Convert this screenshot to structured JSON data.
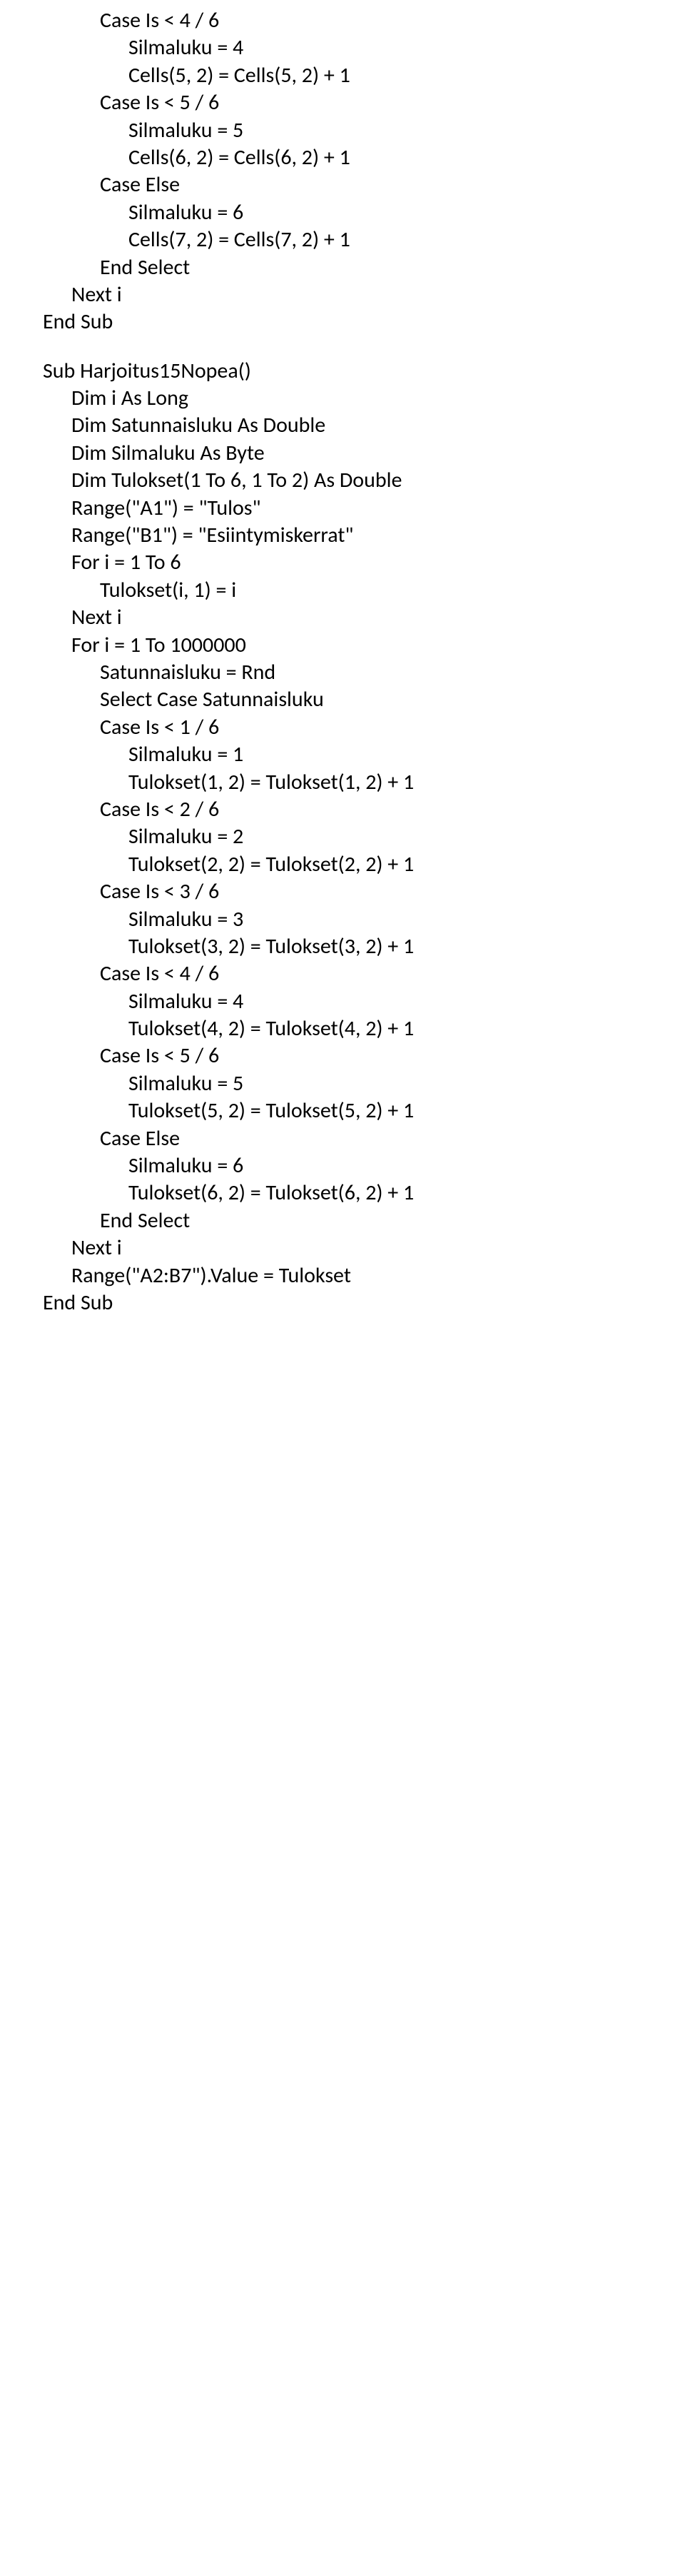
{
  "block1": {
    "l01": "Case Is < 4 / 6",
    "l02": "Silmaluku = 4",
    "l03": "Cells(5, 2) = Cells(5, 2) + 1",
    "l04": "Case Is < 5 / 6",
    "l05": "Silmaluku = 5",
    "l06": "Cells(6, 2) = Cells(6, 2) + 1",
    "l07": "Case Else",
    "l08": "Silmaluku = 6",
    "l09": "Cells(7, 2) = Cells(7, 2) + 1",
    "l10": "End Select",
    "l11": "Next i",
    "l12": "End Sub"
  },
  "block2": {
    "l01": "Sub Harjoitus15Nopea()",
    "l02": "Dim i As Long",
    "l03": "Dim Satunnaisluku As Double",
    "l04": "Dim Silmaluku As Byte",
    "l05": "Dim Tulokset(1 To 6, 1 To 2) As Double",
    "l06": "Range(\"A1\") = \"Tulos\"",
    "l07": "Range(\"B1\") = \"Esiintymiskerrat\"",
    "l08": "For i = 1 To 6",
    "l09": "Tulokset(i, 1) = i",
    "l10": "Next i",
    "l11": "For i = 1 To 1000000",
    "l12": "Satunnaisluku = Rnd",
    "l13": "Select Case Satunnaisluku",
    "l14": "Case Is < 1 / 6",
    "l15": "Silmaluku = 1",
    "l16": "Tulokset(1, 2) = Tulokset(1, 2) + 1",
    "l17": "Case Is < 2 / 6",
    "l18": "Silmaluku = 2",
    "l19": "Tulokset(2, 2) = Tulokset(2, 2) + 1",
    "l20": "Case Is < 3 / 6",
    "l21": "Silmaluku = 3",
    "l22": "Tulokset(3, 2) = Tulokset(3, 2) + 1",
    "l23": "Case Is < 4 / 6",
    "l24": "Silmaluku = 4",
    "l25": "Tulokset(4, 2) = Tulokset(4, 2) + 1",
    "l26": "Case Is < 5 / 6",
    "l27": "Silmaluku = 5",
    "l28": "Tulokset(5, 2) = Tulokset(5, 2) + 1",
    "l29": "Case Else",
    "l30": "Silmaluku = 6",
    "l31": "Tulokset(6, 2) = Tulokset(6, 2) + 1",
    "l32": "End Select",
    "l33": "Next i",
    "l34": "Range(\"A2:B7\").Value = Tulokset",
    "l35": "End Sub"
  }
}
